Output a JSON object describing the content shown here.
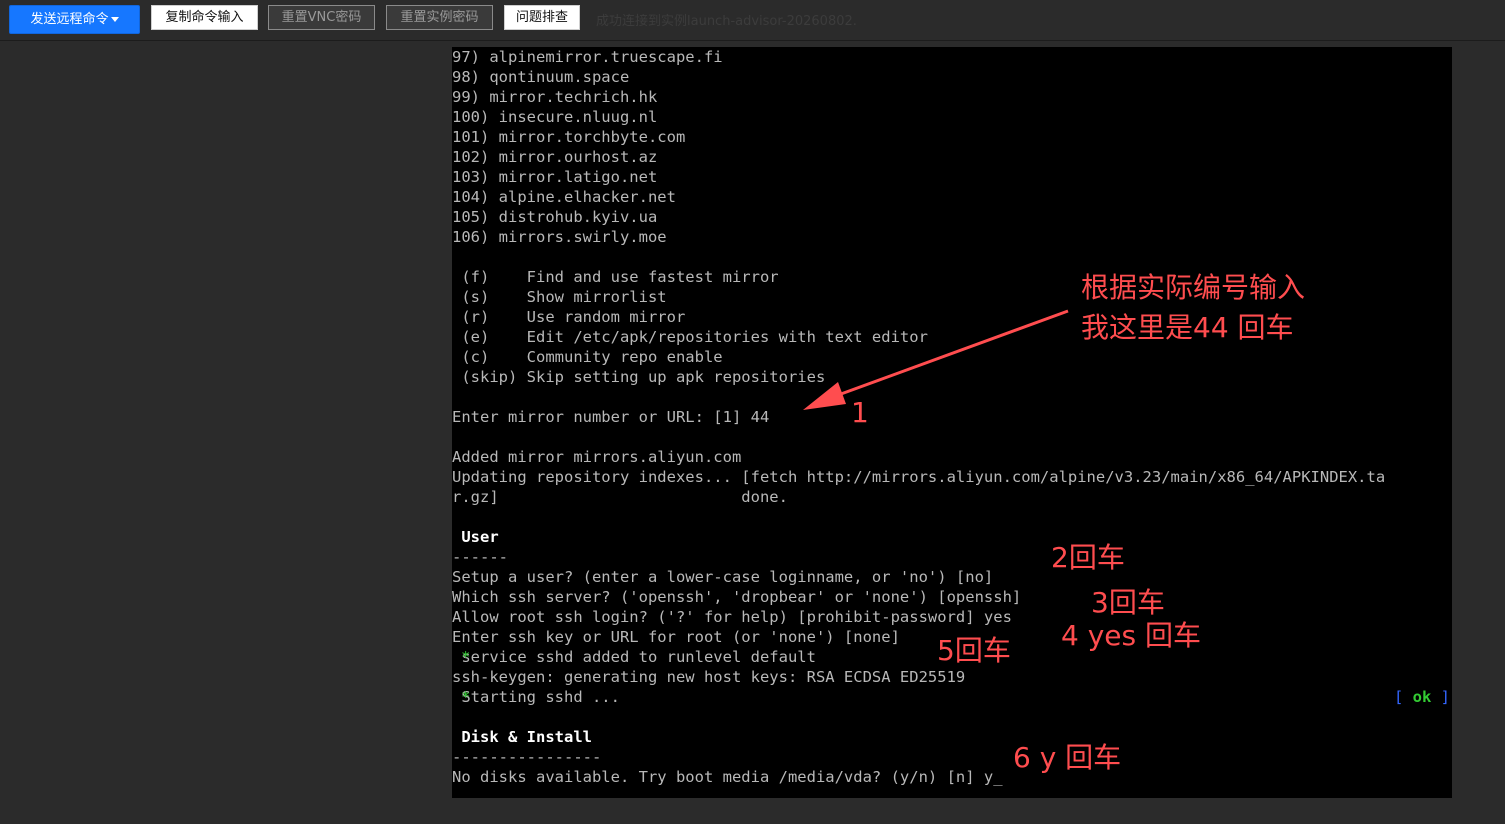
{
  "toolbar": {
    "send_remote": "发送远程命令",
    "copy_input": "复制命令输入",
    "reset_vnc": "重置VNC密码",
    "reset_instance": "重置实例密码",
    "troubleshoot": "问题排查",
    "status": "成功连接到实例launch-advisor-20260802."
  },
  "terminal": {
    "lines": [
      "97) alpinemirror.truescape.fi",
      "98) qontinuum.space",
      "99) mirror.techrich.hk",
      "100) insecure.nluug.nl",
      "101) mirror.torchbyte.com",
      "102) mirror.ourhost.az",
      "103) mirror.latigo.net",
      "104) alpine.elhacker.net",
      "105) distrohub.kyiv.ua",
      "106) mirrors.swirly.moe",
      "",
      " (f)    Find and use fastest mirror",
      " (s)    Show mirrorlist",
      " (r)    Use random mirror",
      " (e)    Edit /etc/apk/repositories with text editor",
      " (c)    Community repo enable",
      " (skip) Skip setting up apk repositories",
      "",
      "Enter mirror number or URL: [1] 44",
      "",
      "Added mirror mirrors.aliyun.com",
      "Updating repository indexes... [fetch http://mirrors.aliyun.com/alpine/v3.23/main/x86_64/APKINDEX.ta",
      "r.gz]                          done.",
      "",
      " User",
      "------",
      "Setup a user? (enter a lower-case loginname, or 'no') [no]",
      "Which ssh server? ('openssh', 'dropbear' or 'none') [openssh]",
      "Allow root ssh login? ('?' for help) [prohibit-password] yes",
      "Enter ssh key or URL for root (or 'none') [none]",
      " service sshd added to runlevel default",
      "ssh-keygen: generating new host keys: RSA ECDSA ED25519",
      " Starting sshd ...",
      "",
      " Disk & Install",
      "----------------",
      "No disks available. Try boot media /media/vda? (y/n) [n] y"
    ],
    "star": "*",
    "cursor": "_",
    "ok_open": "[ ",
    "ok_text": "ok",
    "ok_close": " ]"
  },
  "annotations": {
    "note_main_1": "根据实际编号输入",
    "note_main_2": "我这里是44 回车",
    "step1": "1",
    "step2": "2回车",
    "step3": "3回车",
    "step4": "4 yes 回车",
    "step5": "5回车",
    "step6": "6   y 回车",
    "color": "#ff4d4f"
  }
}
